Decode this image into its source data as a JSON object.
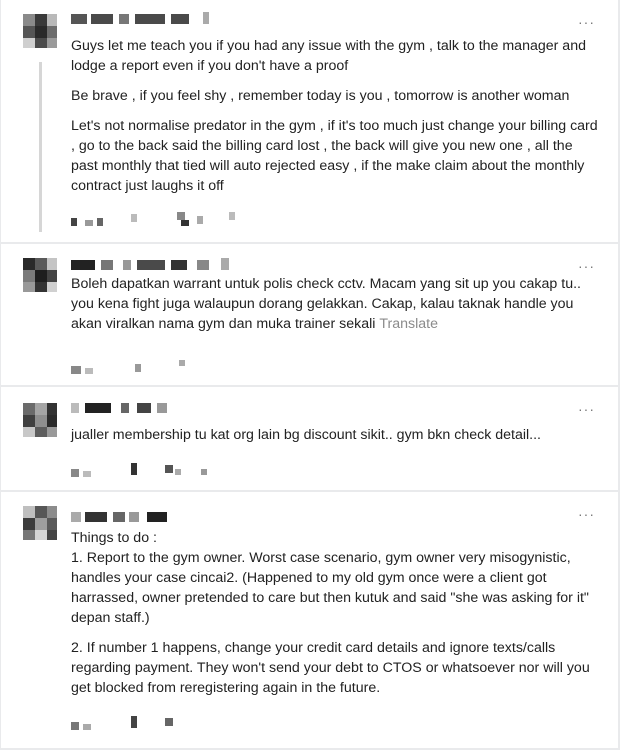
{
  "comments": [
    {
      "paragraphs": [
        "Guys let me teach you if you had any issue with the gym , talk to the manager and lodge a report even if you don't have a proof",
        "Be brave , if you feel shy , remember today is you , tomorrow is another woman",
        "Let's not normalise predator in the gym , if it's too much just change your billing card , go to the back said the billing card lost , the back will give you new one , all the past monthly that tied will auto rejected easy , if the make claim about the monthly contract just laughs it off"
      ]
    },
    {
      "paragraphs": [
        "Boleh dapatkan warrant untuk polis check cctv. Macam yang sit up you cakap tu.. you kena fight juga walaupun dorang gelakkan. Cakap, kalau taknak handle you akan viralkan nama gym dan muka trainer sekali"
      ],
      "translate_label": "Translate"
    },
    {
      "paragraphs": [
        "jualler membership tu kat org lain bg discount sikit.. gym bkn check detail..."
      ]
    },
    {
      "paragraphs": [
        "Things to do :",
        "1. Report to the gym owner. Worst case scenario, gym owner very misogynistic, handles your case cincai2. (Happened to my old gym once were a client got harrassed, owner pretended to care but then kutuk and said \"she was asking for it\" depan staff.)",
        "2. If number 1 happens, change your credit card details and ignore texts/calls regarding payment. They won't send your debt to CTOS or whatsoever nor will you get blocked from reregistering again in the future."
      ]
    }
  ],
  "more_label": "···",
  "icons": [
    "more-options-icon",
    "avatar-blurred"
  ]
}
